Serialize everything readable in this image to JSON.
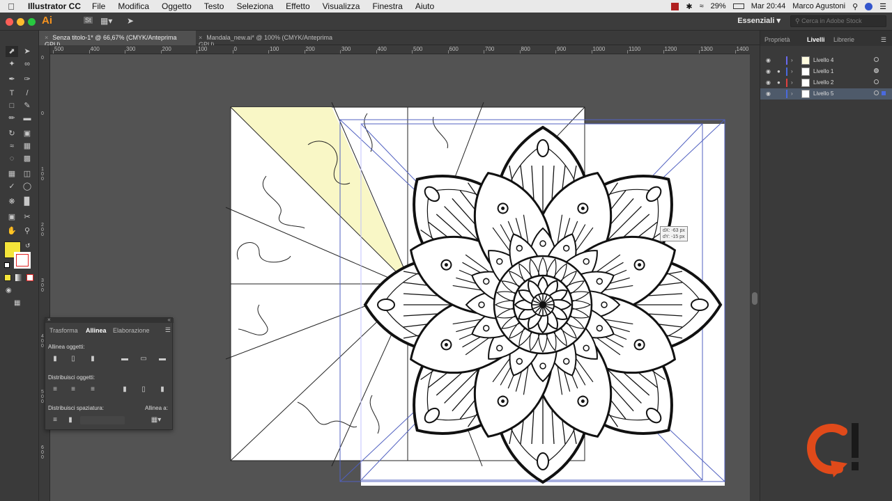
{
  "menubar": {
    "app_name": "Illustrator CC",
    "items": [
      "File",
      "Modifica",
      "Oggetto",
      "Testo",
      "Seleziona",
      "Effetto",
      "Visualizza",
      "Finestra",
      "Aiuto"
    ],
    "battery": "29%",
    "clock": "Mar 20:44",
    "user": "Marco Agustoni"
  },
  "appbar": {
    "logo": "Ai",
    "st_label": "St",
    "workspace": "Essenziali",
    "stock_placeholder": "Cerca in Adobe Stock"
  },
  "tabs": [
    {
      "label": "Senza titolo-1* @ 66,67% (CMYK/Anteprima GPU)",
      "active": true
    },
    {
      "label": "Mandala_new.ai* @ 100% (CMYK/Anteprima GPU)",
      "active": false
    }
  ],
  "ruler": {
    "top_labels": [
      "500",
      "400",
      "300",
      "200",
      "100",
      "0",
      "100",
      "200",
      "300",
      "400",
      "500",
      "600",
      "700",
      "800",
      "900",
      "1000",
      "1100",
      "1200",
      "1300",
      "1400"
    ],
    "left_labels": [
      "0",
      "0",
      "1 0 0",
      "2 0 0",
      "3 0 0",
      "4 0 0",
      "5 0 0",
      "6 0 0",
      "1 0 0"
    ]
  },
  "right_panel": {
    "tabs": [
      "Proprietà",
      "Livelli",
      "Librerie"
    ],
    "layers": [
      {
        "name": "Livello 4",
        "color": "#6a6af0",
        "locked": false,
        "selected": false
      },
      {
        "name": "Livello 1",
        "color": "#4a6adf",
        "locked": true,
        "selected": false
      },
      {
        "name": "Livello 2",
        "color": "#e04040",
        "locked": true,
        "selected": false
      },
      {
        "name": "Livello 5",
        "color": "#4a6adf",
        "locked": false,
        "selected": true
      }
    ]
  },
  "align_panel": {
    "tabs": [
      "Trasforma",
      "Allinea",
      "Elaborazione"
    ],
    "align_objects_label": "Allinea oggetti:",
    "distribute_objects_label": "Distribuisci oggetti:",
    "distribute_spacing_label": "Distribuisci spaziatura:",
    "align_to_label": "Allinea a:"
  },
  "canvas": {
    "dx_readout": "dX: -63 px",
    "dy_readout": "dY: -15 px",
    "fill_color": "#f5e53a"
  }
}
